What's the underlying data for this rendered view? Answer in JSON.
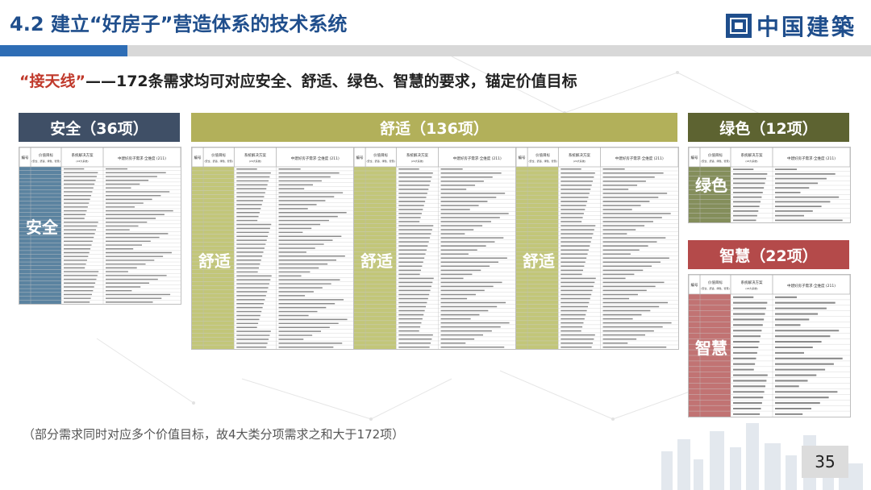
{
  "title": "4.2 建立“好房子”营造体系的技术系统",
  "logo": {
    "text": "中国建築",
    "icon": "cscec-logo-icon"
  },
  "headline": {
    "highlight": "“接天线”",
    "rest": "——172条需求均可对应安全、舒适、绿色、智慧的要求，锚定价值目标"
  },
  "categories": {
    "safety": {
      "header": "安全（36项）",
      "overlay": "安全",
      "color": "#3f4f66",
      "col_color": "#3e6d8f"
    },
    "comfort": {
      "header": "舒适（136项）",
      "overlay": "舒适",
      "color": "#b2b05a",
      "col_color": "#b7bc62"
    },
    "green": {
      "header": "绿色（12项）",
      "overlay": "绿色",
      "color": "#5d6331",
      "col_color": "#6f7a3e"
    },
    "smart": {
      "header": "智慧（22项）",
      "overlay": "智慧",
      "color": "#b44a4a",
      "col_color": "#b65a5a"
    }
  },
  "table_headers": {
    "no": "编号",
    "value": "价值目标",
    "value_sub": "(安全、舒适、绿色、智慧)",
    "solution": "系统解决方案",
    "solution_sub": "(24大系统)",
    "demand": "中建好房子需求·全维度 (211)"
  },
  "footnote": "（部分需求同时对应多个价值目标，故4大类分项需求之和大于172项）",
  "page_number": "35"
}
